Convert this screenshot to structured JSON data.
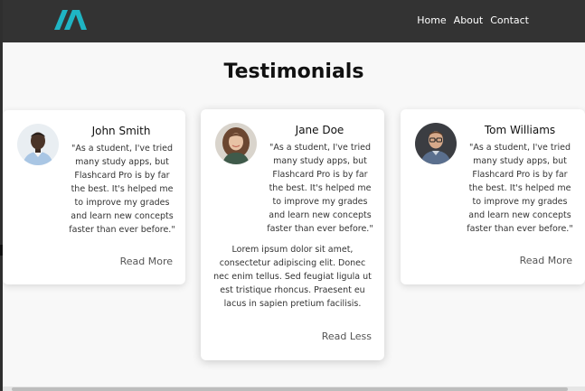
{
  "nav": {
    "links": [
      "Home",
      "About",
      "Contact"
    ]
  },
  "brand": {
    "logo_icon": "teal-triangle-logo",
    "accent_color": "#1fb5c4"
  },
  "section": {
    "title": "Testimonials"
  },
  "testimonials": [
    {
      "name": "John Smith",
      "quote": "\"As a student, I've tried many study apps, but Flashcard Pro is by far the best. It's helped me to improve my grades and learn new concepts faster than ever before.\"",
      "expanded_text": "",
      "toggle_label": "Read More",
      "avatar": "avatar-man-dark-hair"
    },
    {
      "name": "Jane Doe",
      "quote": "\"As a student, I've tried many study apps, but Flashcard Pro is by far the best. It's helped me to improve my grades and learn new concepts faster than ever before.\"",
      "expanded_text": "Lorem ipsum dolor sit amet, consectetur adipiscing elit. Donec nec enim tellus. Sed feugiat ligula ut est tristique rhoncus. Praesent eu lacus in sapien pretium facilisis.",
      "toggle_label": "Read Less",
      "avatar": "avatar-woman-curly-hair"
    },
    {
      "name": "Tom Williams",
      "quote": "\"As a student, I've tried many study apps, but Flashcard Pro is by far the best. It's helped me to improve my grades and learn new concepts faster than ever before.\"",
      "expanded_text": "",
      "toggle_label": "Read More",
      "avatar": "avatar-man-glasses"
    }
  ]
}
